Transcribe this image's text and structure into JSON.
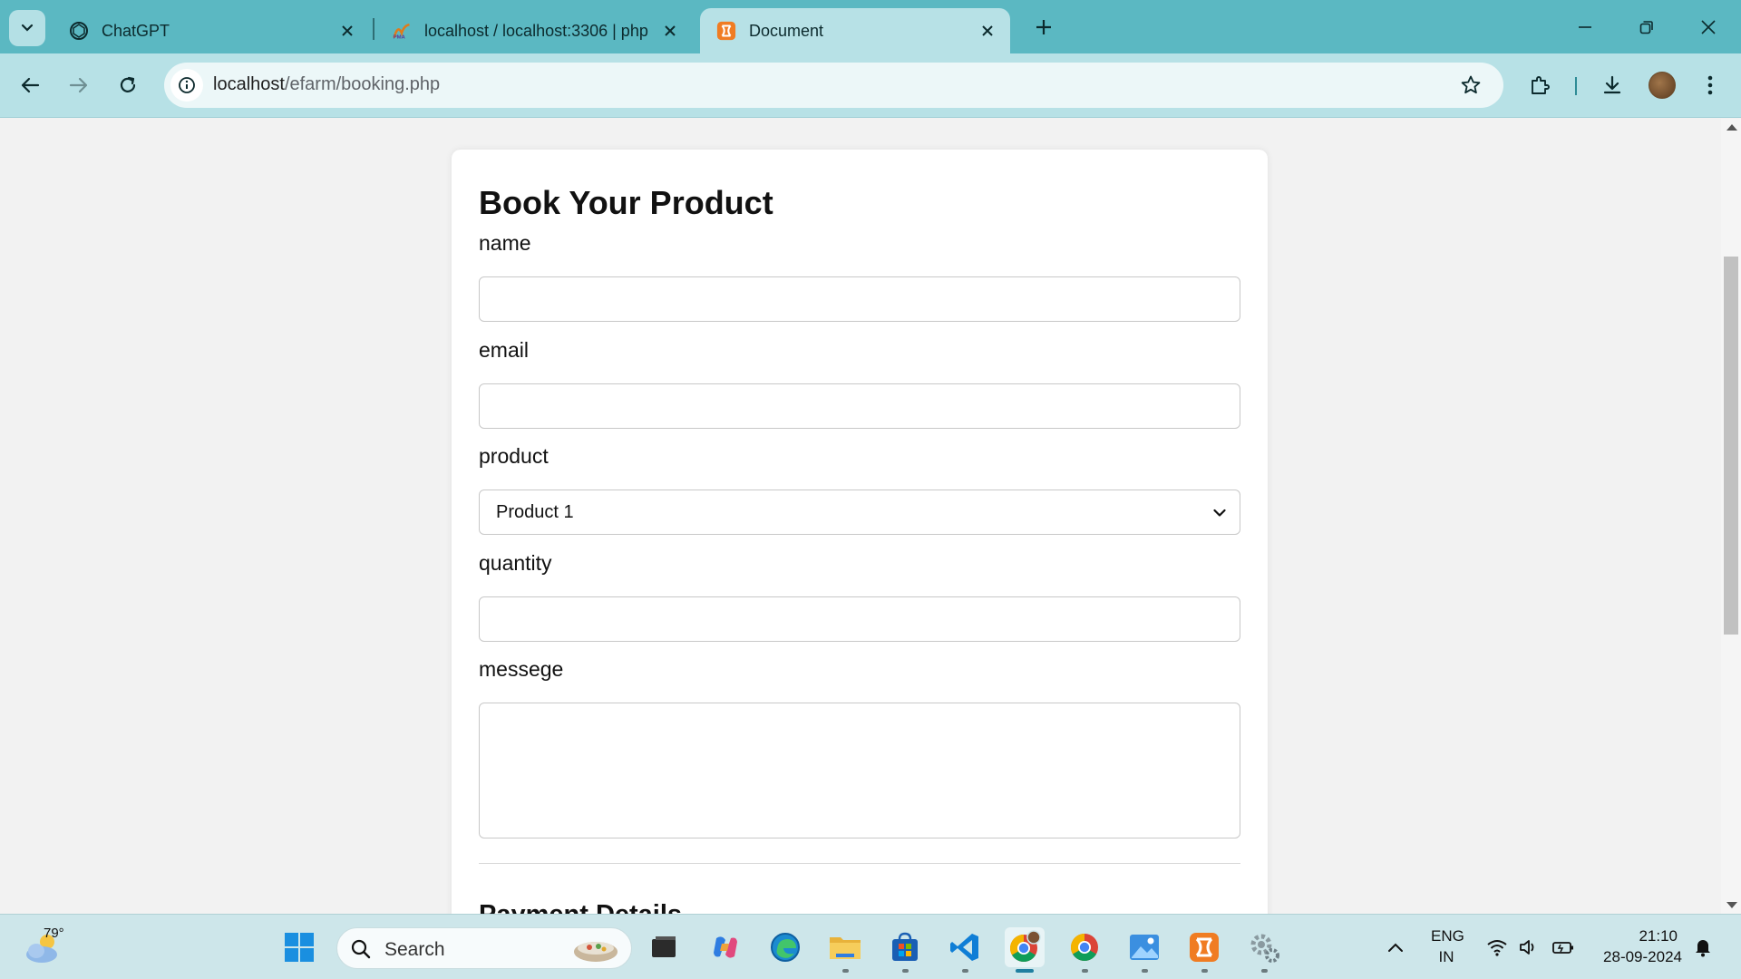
{
  "browser": {
    "tabs": [
      {
        "title": "ChatGPT",
        "icon": "chatgpt-icon"
      },
      {
        "title": "localhost / localhost:3306 | php",
        "icon": "phpmyadmin-icon"
      },
      {
        "title": "Document",
        "icon": "xampp-icon",
        "active": true
      }
    ],
    "url_host": "localhost",
    "url_path": "/efarm/booking.php"
  },
  "page": {
    "title": "Book Your Product",
    "form": {
      "name_label": "name",
      "name_value": "",
      "email_label": "email",
      "email_value": "",
      "product_label": "product",
      "product_selected": "Product 1",
      "quantity_label": "quantity",
      "quantity_value": "",
      "message_label": "messege",
      "message_value": ""
    },
    "payment_heading": "Payment Details"
  },
  "taskbar": {
    "weather_temp": "79°",
    "search_placeholder": "Search",
    "language": "ENG",
    "region": "IN",
    "time": "21:10",
    "date": "28-09-2024"
  },
  "colors": {
    "tabstrip": "#5bb8c2",
    "toolbar": "#b7e1e6",
    "page_bg": "#f2f2f2",
    "card_bg": "#ffffff",
    "taskbar": "#cde6ea"
  }
}
